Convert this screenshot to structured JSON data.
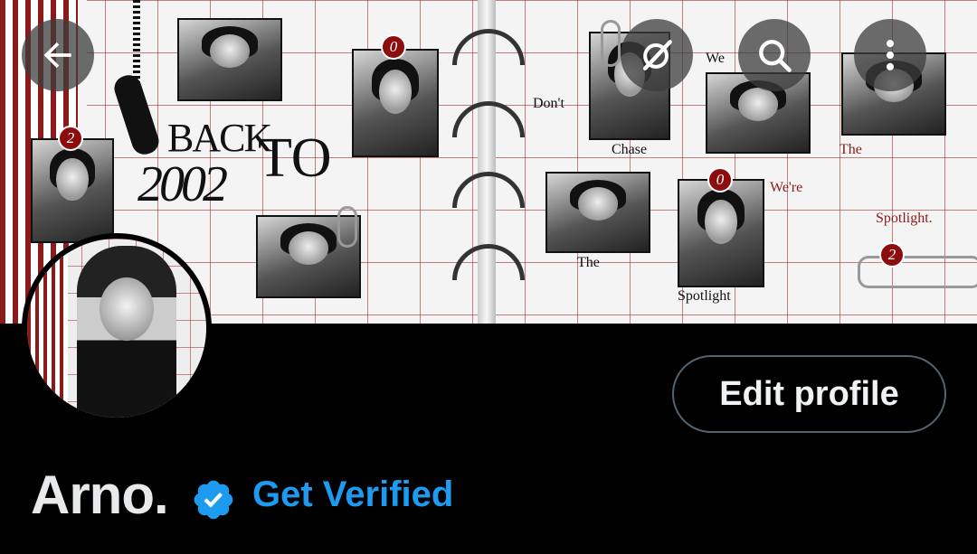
{
  "banner": {
    "title_back": "BACK",
    "title_to": "TO",
    "title_year": "2002",
    "words": [
      "Don't",
      "We",
      "Chase",
      "The",
      "We're",
      "Spotlight.",
      "The",
      "Spotlight"
    ],
    "badges": [
      "2",
      "0",
      "0",
      "2"
    ],
    "accent_color": "#8b1a1a"
  },
  "nav": {
    "back_icon": "arrow-left-icon",
    "grok_icon": "grok-icon",
    "search_icon": "search-icon",
    "more_icon": "more-vertical-icon"
  },
  "profile": {
    "edit_label": "Edit profile",
    "name": "Arno.",
    "verified_icon": "verified-badge-icon",
    "get_verified_label": "Get Verified",
    "verified_color": "#1d9bf0"
  }
}
